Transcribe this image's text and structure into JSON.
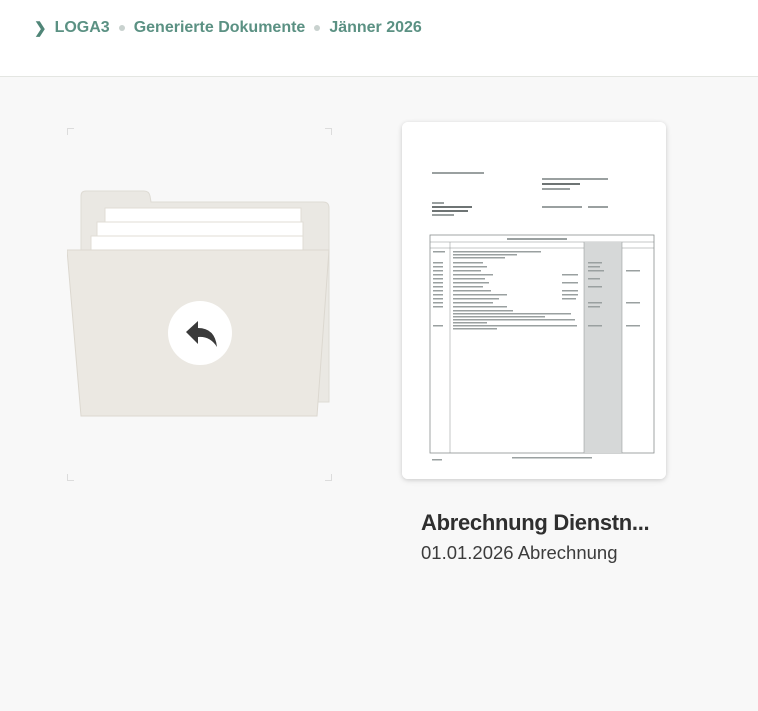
{
  "breadcrumb": {
    "items": [
      "LOGA3",
      "Generierte Dokumente",
      "Jänner 2026"
    ]
  },
  "folder_up": {
    "icon": "back-arrow-icon"
  },
  "document": {
    "title": "Abrechnung Dienstn...",
    "subtitle": "01.01.2026 Abrechnung"
  },
  "colors": {
    "breadcrumb_text": "#5b9183",
    "folder_fill": "#ebe8e2",
    "content_bg": "#f8f8f8"
  }
}
